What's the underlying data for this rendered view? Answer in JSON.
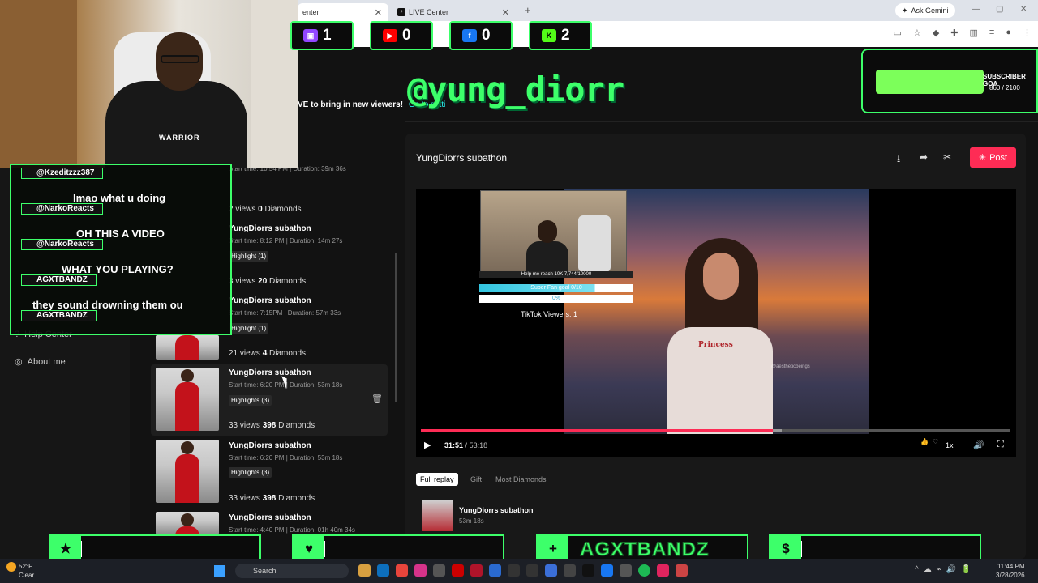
{
  "browser": {
    "tabs": [
      {
        "label": "enter"
      },
      {
        "label": "LIVE Center"
      }
    ],
    "new_tab": "+",
    "ask_gemini": "Ask Gemini",
    "window_controls": [
      "—",
      "▢",
      "✕"
    ]
  },
  "page": {
    "promo_text": "VE to bring in new viewers!",
    "promo_link": "Go to setti",
    "nav": [
      {
        "label": "Help Center",
        "icon": "help-icon"
      },
      {
        "label": "About me",
        "icon": "person-icon"
      }
    ],
    "list": {
      "partial_meta": "Start time: 10:54 PM | Duration: 39m 36s",
      "rows": [
        {
          "stats_views": "2 views",
          "stats_diamonds_num": "0",
          "stats_diamonds": "Diamonds",
          "title": "YungDiorrs subathon",
          "meta": "Start time: 8:12 PM | Duration: 14m 27s",
          "badge": "Highlight (1)"
        },
        {
          "stats_views": "3 views",
          "stats_diamonds_num": "20",
          "stats_diamonds": "Diamonds",
          "title": "YungDiorrs subathon",
          "meta": "Start time: 7:15PM | Duration: 57m 33s",
          "badge": "Highlight (1)"
        },
        {
          "stats_views": "21 views",
          "stats_diamonds_num": "4",
          "stats_diamonds": "Diamonds",
          "title": "YungDiorrs subathon",
          "meta": "Start time: 6:20 PM | Duration: 53m 18s",
          "badge": "Highlights (3)"
        },
        {
          "stats_views": "33 views",
          "stats_diamonds_num": "398",
          "stats_diamonds": "Diamonds",
          "title": "YungDiorrs subathon",
          "meta": "Start time: 6:20 PM | Duration: 53m 18s",
          "badge": "Highlights (3)"
        },
        {
          "stats_views": "33 views",
          "stats_diamonds_num": "398",
          "stats_diamonds": "Diamonds",
          "title": "YungDiorrs subathon",
          "meta": "Start time: 4:40 PM | Duration: 01h 40m 34s",
          "badge": ""
        }
      ]
    },
    "detail": {
      "title": "YungDiorrs subathon",
      "post_label": "Post",
      "player": {
        "time_current": "31:51",
        "time_total": "53:18",
        "speed": "1x",
        "progress_fraction": 0.597,
        "buffer_fraction": 0.015,
        "shirt_text": "Princess",
        "watermark": "@aestheticbeings",
        "goal_top": "Help me reach 10K 7,744/10000",
        "super_fan_goal": "Super Fan goal 0/10",
        "percent": "0%",
        "tiktok_viewers": "TikTok Viewers: 1"
      },
      "chips": [
        {
          "label": "Full replay",
          "active": true
        },
        {
          "label": "Gift",
          "active": false
        },
        {
          "label": "Most Diamonds",
          "active": false
        }
      ],
      "replay": {
        "title": "YungDiorrs subathon",
        "length": "53m 18s"
      }
    }
  },
  "overlay": {
    "handle": "@yung_diorr",
    "counters": [
      {
        "platform": "twitch",
        "icon": "twitch-icon",
        "value": "1",
        "color": "#9146ff"
      },
      {
        "platform": "youtube",
        "icon": "youtube-icon",
        "value": "0",
        "color": "#ff0000"
      },
      {
        "platform": "facebook",
        "icon": "facebook-icon",
        "value": "0",
        "color": "#1877f2"
      },
      {
        "platform": "kick",
        "icon": "kick-icon",
        "value": "2",
        "color": "#53fc18"
      }
    ],
    "sub_goal": {
      "label": "SUBSCRIBER GOA",
      "count": "860 / 2100",
      "fraction": 0.41
    },
    "chat": [
      {
        "name": "@Kzeditzzz387",
        "message": "lmao what u doing"
      },
      {
        "name": "@NarkoReacts",
        "message": "OH THIS A VIDEO"
      },
      {
        "name": "@NarkoReacts",
        "message": "WHAT YOU PLAYING?"
      },
      {
        "name": "AGXTBANDZ",
        "message": "they sound drowning them ou"
      },
      {
        "name": "AGXTBANDZ",
        "message": ""
      }
    ],
    "webcam_logo": "WARRIOR",
    "bottom_widgets": [
      {
        "icon": "star-icon",
        "glyph": "★",
        "name": ""
      },
      {
        "icon": "heart-icon",
        "glyph": "♥",
        "name": ""
      },
      {
        "icon": "add-user-icon",
        "glyph": "+",
        "name": "AGXTBANDZ"
      },
      {
        "icon": "dollar-icon",
        "glyph": "$",
        "name": ""
      }
    ]
  },
  "taskbar": {
    "temp": "52°F",
    "weather": "Clear",
    "search_placeholder": "Search",
    "time": "11:44 PM",
    "date": "3/28/2026"
  },
  "colors": {
    "accent_green": "#3dff6a",
    "tiktok_red": "#fe2c55"
  }
}
